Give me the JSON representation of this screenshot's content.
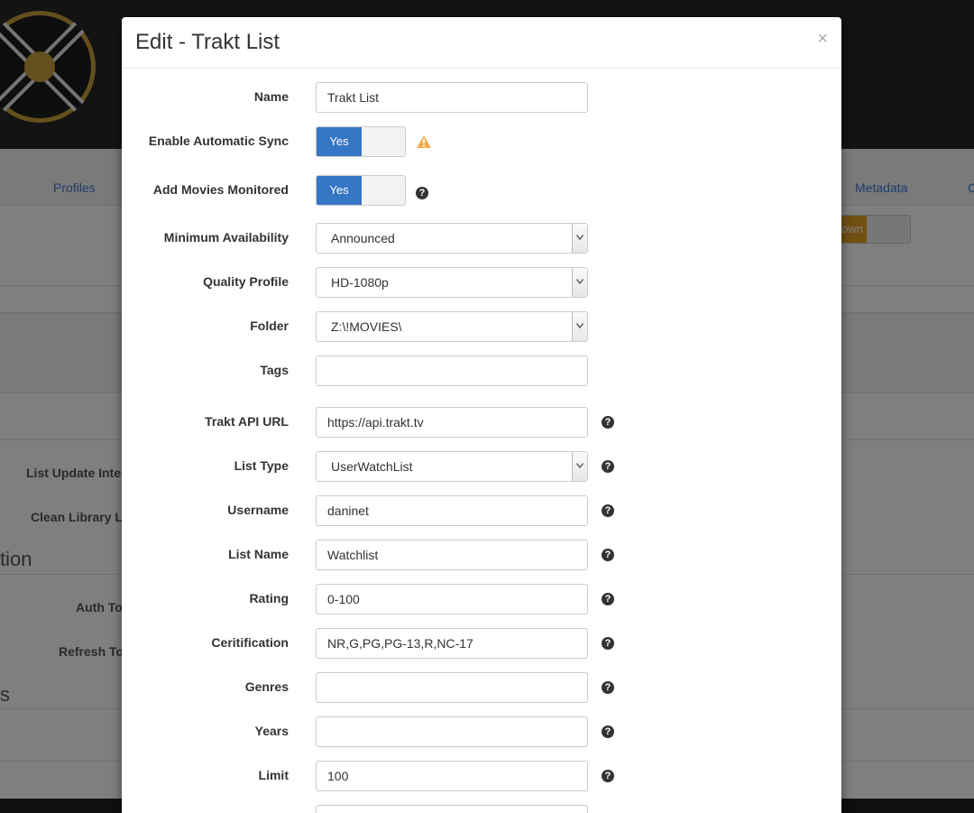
{
  "background": {
    "nav": [
      "Profiles",
      "Metadata",
      "C"
    ],
    "toggle_label": "own",
    "labels": [
      "List Update Inte",
      "Clean Library L",
      "Auth To",
      "Refresh To"
    ],
    "sections": [
      "tion",
      "s"
    ]
  },
  "modal": {
    "title": "Edit - Trakt List",
    "close": "×",
    "fields": {
      "name": {
        "label": "Name",
        "value": "Trakt List"
      },
      "auto_sync": {
        "label": "Enable Automatic Sync",
        "value": "Yes"
      },
      "monitored": {
        "label": "Add Movies Monitored",
        "value": "Yes"
      },
      "min_availability": {
        "label": "Minimum Availability",
        "value": "Announced"
      },
      "quality_profile": {
        "label": "Quality Profile",
        "value": "HD-1080p"
      },
      "folder": {
        "label": "Folder",
        "value": "Z:\\!MOVIES\\"
      },
      "tags": {
        "label": "Tags",
        "value": ""
      },
      "api_url": {
        "label": "Trakt API URL",
        "value": "https://api.trakt.tv"
      },
      "list_type": {
        "label": "List Type",
        "value": "UserWatchList"
      },
      "username": {
        "label": "Username",
        "value": "daninet"
      },
      "list_name": {
        "label": "List Name",
        "value": "Watchlist"
      },
      "rating": {
        "label": "Rating",
        "value": "0-100"
      },
      "certification": {
        "label": "Ceritification",
        "value": "NR,G,PG,PG-13,R,NC-17"
      },
      "genres": {
        "label": "Genres",
        "value": ""
      },
      "years": {
        "label": "Years",
        "value": ""
      },
      "limit": {
        "label": "Limit",
        "value": "100"
      }
    },
    "help_glyph": "?"
  }
}
